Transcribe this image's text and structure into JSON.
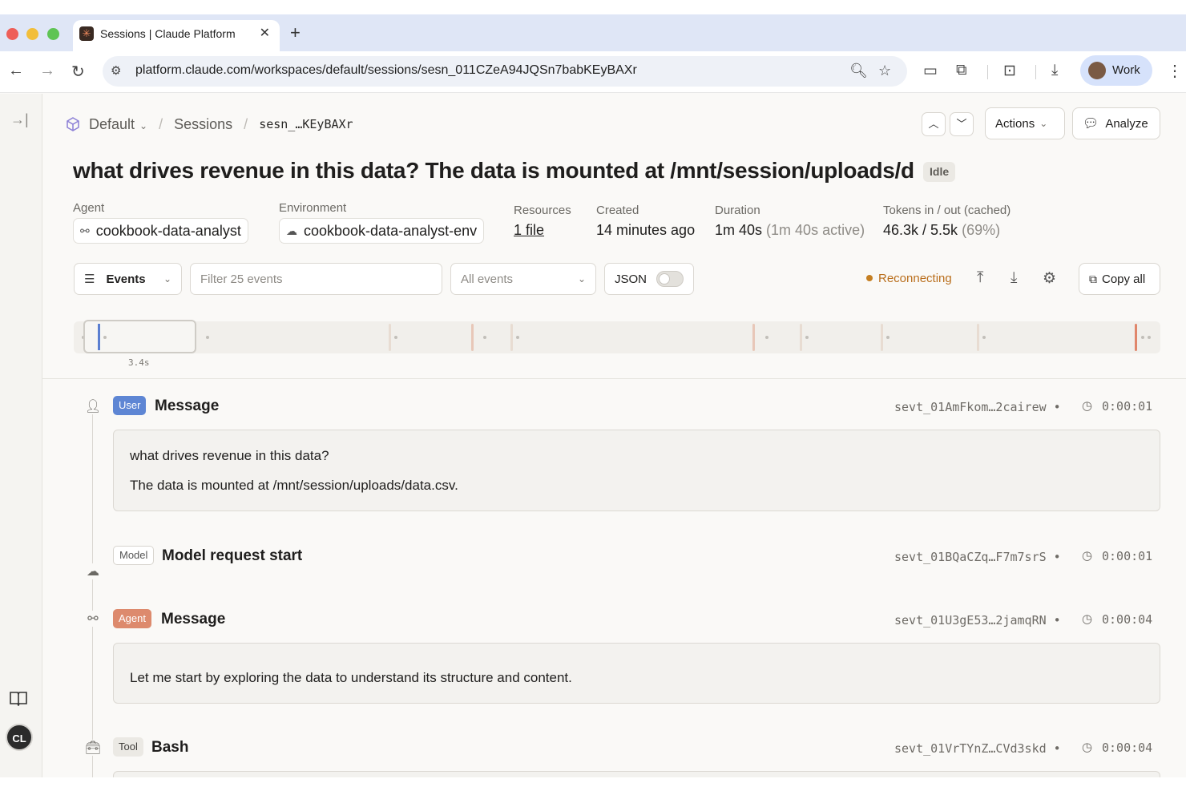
{
  "browser": {
    "tab_title": "Sessions | Claude Platform",
    "tab_close": "✕",
    "new_tab": "+",
    "url": "platform.claude.com/workspaces/default/sessions/sesn_011CZeA94JQSn7babKEyBAXr",
    "profile_label": "Work"
  },
  "breadcrumb": {
    "workspace": "Default",
    "section": "Sessions",
    "session_id": "sesn_…KEyBAXr"
  },
  "header": {
    "actions_label": "Actions",
    "analyze_label": "Analyze"
  },
  "session": {
    "title": "what drives revenue in this data? The data is mounted at /mnt/session/uploads/d",
    "status": "Idle",
    "agent_label": "Agent",
    "agent_value": "cookbook-data-analyst",
    "environment_label": "Environment",
    "environment_value": "cookbook-data-analyst-env",
    "resources_label": "Resources",
    "resources_value": "1 file",
    "created_label": "Created",
    "created_value": "14 minutes ago",
    "duration_label": "Duration",
    "duration_value": "1m 40s",
    "duration_active": "(1m 40s active)",
    "tokens_label": "Tokens in / out (cached)",
    "tokens_value": "46.3k / 5.5k",
    "tokens_cached": "(69%)"
  },
  "controls": {
    "view_select": "Events",
    "filter_placeholder": "Filter 25 events",
    "type_select": "All events",
    "json_label": "JSON",
    "json_enabled": false,
    "connection_status": "Reconnecting",
    "copy_all_label": "Copy all",
    "timeline_scale": "3.4s",
    "colors": {
      "reconnecting": "#b96e1c",
      "user_badge": "#5e86d4",
      "agent_badge": "#dd8a6d"
    }
  },
  "events": [
    {
      "badge": "User",
      "title": "Message",
      "id": "sevt_01AmFkom…2cairew",
      "time": "0:00:01",
      "icon": "person-icon",
      "lines": [
        "what drives revenue in this data?",
        "The data is mounted at /mnt/session/uploads/data.csv."
      ]
    },
    {
      "badge": "Model",
      "title": "Model request start",
      "id": "sevt_01BQaCZq…F7m7srS",
      "time": "0:00:01",
      "icon": "cloud-icon"
    },
    {
      "badge": "Agent",
      "title": "Message",
      "id": "sevt_01U3gE53…2jamqRN",
      "time": "0:00:04",
      "icon": "agent-icon",
      "lines": [
        "Let me start by exploring the data to understand its structure and content."
      ]
    },
    {
      "badge": "Tool",
      "title": "Bash",
      "id": "sevt_01VrTYnZ…CVd3skd",
      "time": "0:00:04",
      "icon": "toolbox-icon"
    }
  ],
  "sidebar": {
    "avatar_initials": "CL"
  }
}
